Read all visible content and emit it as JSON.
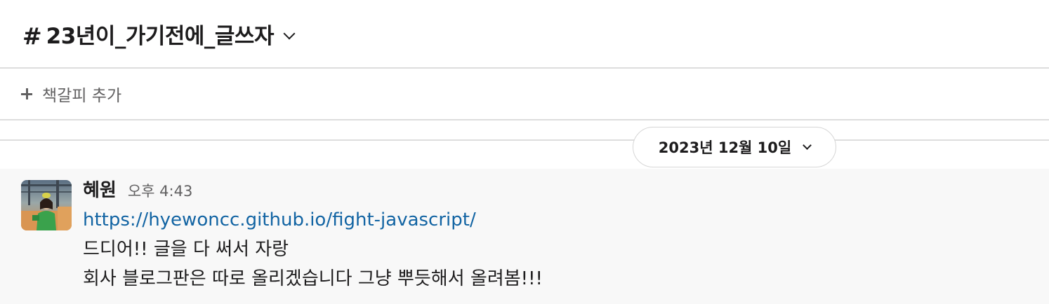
{
  "channel": {
    "hash": "#",
    "name": "23년이_가기전에_글쓰자"
  },
  "bookmarks": {
    "add_label": "책갈피 추가"
  },
  "date_divider": {
    "label": "2023년 12월 10일"
  },
  "message": {
    "sender": "혜원",
    "time": "오후 4:43",
    "link": "https://hyewoncc.github.io/fight-javascript/",
    "lines": [
      "드디어!! 글을 다 써서 자랑",
      "회사 블로그판은 따로 올리겠습니다 그냥 뿌듯해서 올려봄!!!"
    ]
  },
  "colors": {
    "link": "#1264a3",
    "message_bg": "#f8f8f8",
    "divider": "#dddddd",
    "muted_text": "#616061"
  },
  "icons": [
    "chevron-down-icon",
    "plus-icon",
    "avatar-image"
  ]
}
